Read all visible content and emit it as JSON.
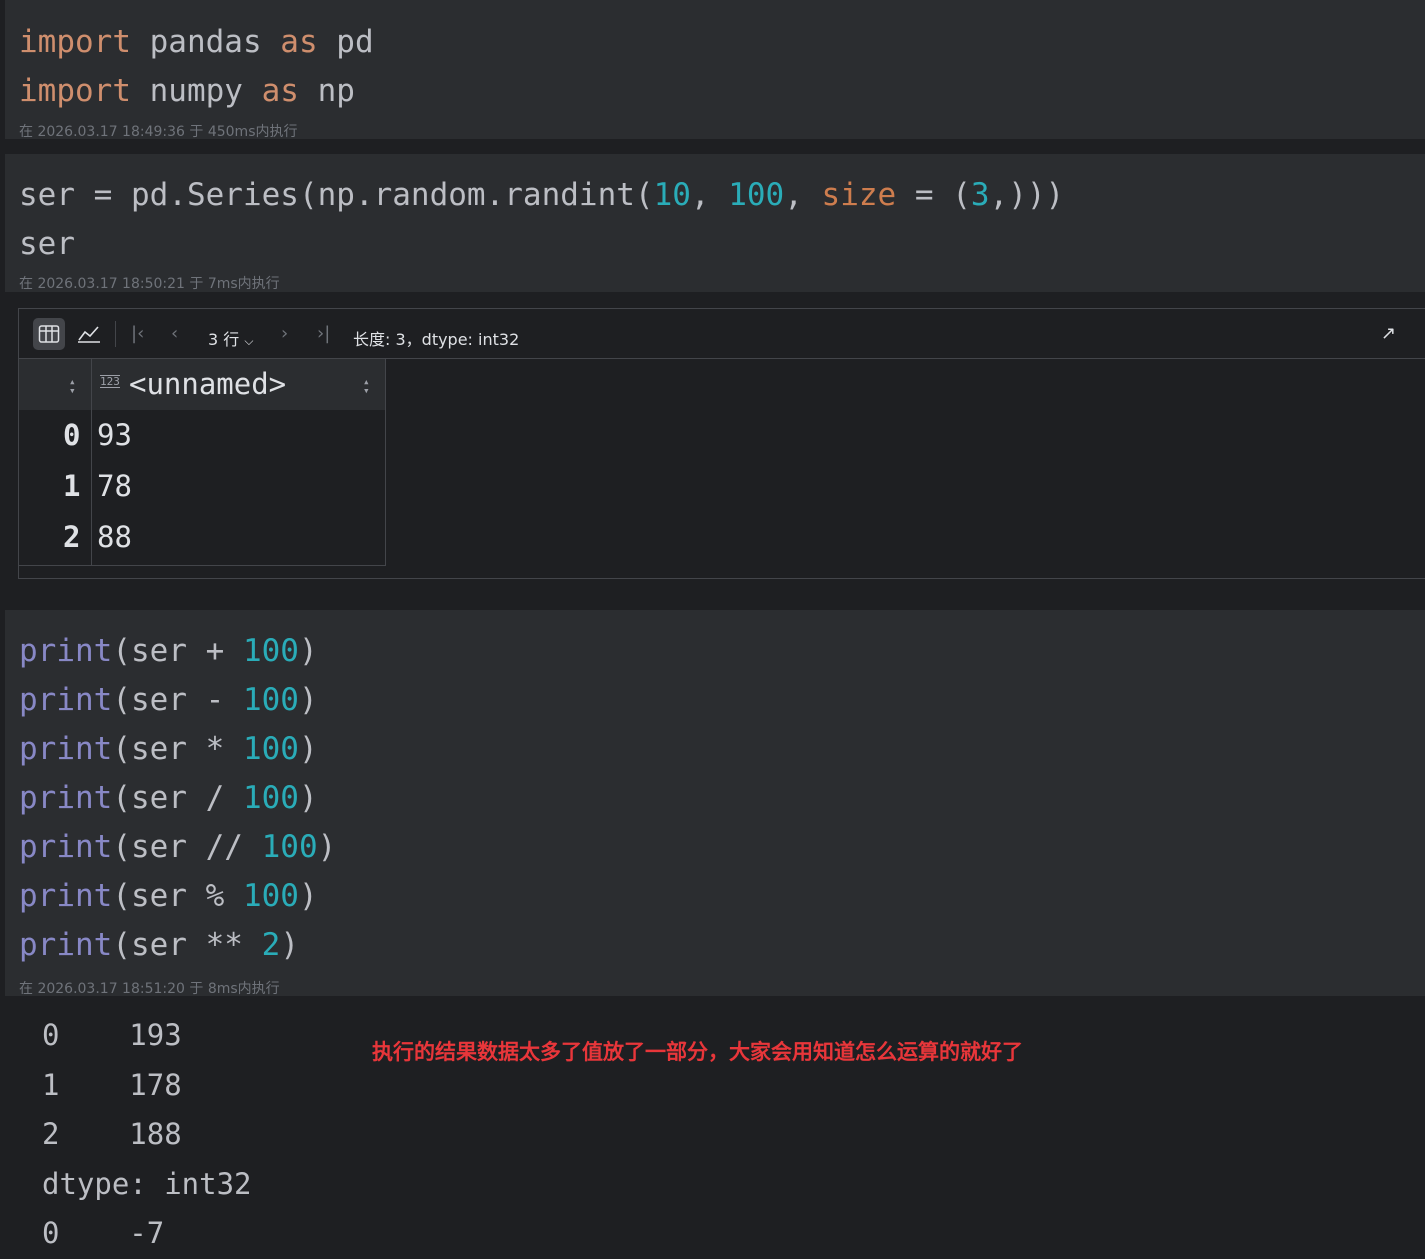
{
  "cells": [
    {
      "lines": [
        [
          {
            "t": "import",
            "c": "kw"
          },
          {
            "t": " pandas "
          },
          {
            "t": "as",
            "c": "kw"
          },
          {
            "t": " pd"
          }
        ],
        [
          {
            "t": "import",
            "c": "kw"
          },
          {
            "t": " numpy "
          },
          {
            "t": "as",
            "c": "kw"
          },
          {
            "t": " np"
          }
        ]
      ],
      "meta": "在 2026.03.17 18:49:36 于 450ms内执行"
    },
    {
      "lines": [
        [
          {
            "t": "ser = pd.Series(np.random.randint("
          },
          {
            "t": "10",
            "c": "num"
          },
          {
            "t": ", "
          },
          {
            "t": "100",
            "c": "num"
          },
          {
            "t": ", "
          },
          {
            "t": "size",
            "c": "param"
          },
          {
            "t": " = ("
          },
          {
            "t": "3",
            "c": "num"
          },
          {
            "t": ",)))"
          }
        ],
        [
          {
            "t": "ser"
          }
        ]
      ],
      "meta": "在 2026.03.17 18:50:21 于 7ms内执行"
    },
    {
      "lines": [
        [
          {
            "t": "print",
            "c": "fn"
          },
          {
            "t": "(ser + "
          },
          {
            "t": "100",
            "c": "num"
          },
          {
            "t": ")"
          }
        ],
        [
          {
            "t": "print",
            "c": "fn"
          },
          {
            "t": "(ser - "
          },
          {
            "t": "100",
            "c": "num"
          },
          {
            "t": ")"
          }
        ],
        [
          {
            "t": "print",
            "c": "fn"
          },
          {
            "t": "(ser * "
          },
          {
            "t": "100",
            "c": "num"
          },
          {
            "t": ")"
          }
        ],
        [
          {
            "t": "print",
            "c": "fn"
          },
          {
            "t": "(ser / "
          },
          {
            "t": "100",
            "c": "num"
          },
          {
            "t": ")"
          }
        ],
        [
          {
            "t": "print",
            "c": "fn"
          },
          {
            "t": "(ser // "
          },
          {
            "t": "100",
            "c": "num"
          },
          {
            "t": ")"
          }
        ],
        [
          {
            "t": "print",
            "c": "fn"
          },
          {
            "t": "(ser % "
          },
          {
            "t": "100",
            "c": "num"
          },
          {
            "t": ")"
          }
        ],
        [
          {
            "t": "print",
            "c": "fn"
          },
          {
            "t": "(ser ** "
          },
          {
            "t": "2",
            "c": "num"
          },
          {
            "t": ")"
          }
        ]
      ],
      "meta": "在 2026.03.17 18:51:20 于 8ms内执行"
    }
  ],
  "table_output": {
    "row_count_label": "3 行",
    "info": "长度: 3，dtype: int32",
    "column_type": "123",
    "column_name": "<unnamed>",
    "rows": [
      {
        "index": "0",
        "value": "93"
      },
      {
        "index": "1",
        "value": "78"
      },
      {
        "index": "2",
        "value": "88"
      }
    ]
  },
  "text_output": [
    "0    193",
    "1    178",
    "2    188",
    "dtype: int32",
    "0    -7"
  ],
  "annotation": "执行的结果数据太多了值放了一部分，大家会用知道怎么运算的就好了"
}
